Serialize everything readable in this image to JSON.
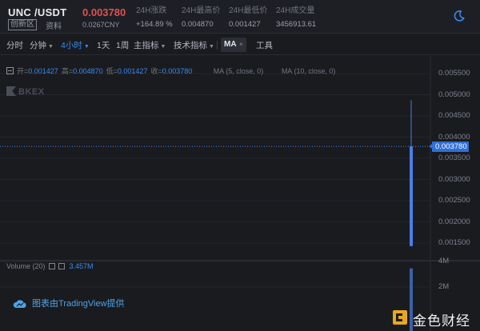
{
  "header": {
    "pair": "UNC /USDT",
    "zone_badge": "创新区",
    "info_link": "资料",
    "price": "0.003780",
    "price_cny": "0.0267CNY",
    "stats": [
      {
        "label": "24H涨跌",
        "value": "+164.89 %"
      },
      {
        "label": "24H最高价",
        "value": "0.004870"
      },
      {
        "label": "24H最低价",
        "value": "0.001427"
      },
      {
        "label": "24H成交量",
        "value": "3456913.61"
      }
    ],
    "theme_icon": "moon-icon"
  },
  "toolbar": {
    "items": [
      {
        "label": "分时",
        "dropdown": false,
        "active": false
      },
      {
        "label": "分钟",
        "dropdown": true,
        "active": false
      },
      {
        "label": "4小时",
        "dropdown": true,
        "active": true
      },
      {
        "label": "1天",
        "dropdown": false,
        "active": false
      },
      {
        "label": "1周",
        "dropdown": false,
        "active": false
      },
      {
        "label": "主指标",
        "dropdown": true,
        "active": false
      },
      {
        "label": "技术指标",
        "dropdown": true,
        "active": false
      }
    ],
    "ma_chip": "MA",
    "ma_close": "×",
    "tools_label": "工具"
  },
  "legend": {
    "open_label": "开=",
    "open": "0.001427",
    "high_label": "高=",
    "high": "0.004870",
    "low_label": "低=",
    "low": "0.001427",
    "close_label": "收=",
    "close": "0.003780",
    "ma5": "MA (5, close, 0)",
    "ma10": "MA (10, close, 0)"
  },
  "logo_text": "BKEX",
  "volume": {
    "label": "Volume (20)",
    "value": "3.457M",
    "axis_ticks": [
      "4M",
      "2M"
    ]
  },
  "price_axis": {
    "ticks": [
      "0.005500",
      "0.005000",
      "0.004500",
      "0.004000",
      "0.003500",
      "0.003000",
      "0.002500",
      "0.002000",
      "0.001500"
    ],
    "current": "0.003780"
  },
  "footer": {
    "tradingview": "图表由TradingView提供",
    "watermark": "金色财经"
  },
  "colors": {
    "accent": "#3a8bf5",
    "price_red": "#e0514f",
    "candle": "#4a7ee6",
    "background": "#1a1b1f"
  },
  "chart_data": {
    "type": "candlestick",
    "candles": [
      {
        "open": 0.001427,
        "high": 0.00487,
        "low": 0.001427,
        "close": 0.00378,
        "volume": 3457000
      }
    ],
    "ylim": [
      0.0014,
      0.0056
    ],
    "volume_ylim": [
      0,
      4800000
    ],
    "grid": true
  }
}
